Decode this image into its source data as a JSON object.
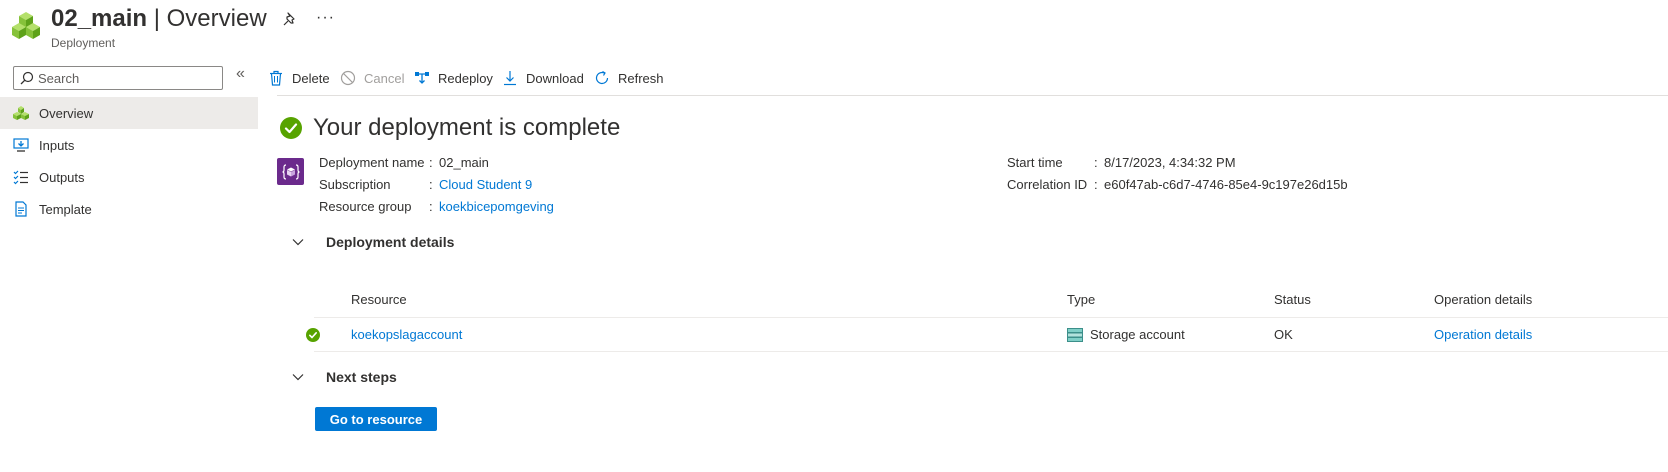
{
  "header": {
    "title_name": "02_main",
    "title_separator": " | ",
    "title_page": "Overview",
    "subtitle": "Deployment",
    "more_label": "···"
  },
  "sidebar": {
    "search_placeholder": "Search",
    "collapse_glyph": "«",
    "items": [
      {
        "label": "Overview",
        "icon": "deployment-cubes-icon",
        "active": true
      },
      {
        "label": "Inputs",
        "icon": "inputs-icon",
        "active": false
      },
      {
        "label": "Outputs",
        "icon": "outputs-icon",
        "active": false
      },
      {
        "label": "Template",
        "icon": "template-icon",
        "active": false
      }
    ]
  },
  "toolbar": {
    "delete": "Delete",
    "cancel": "Cancel",
    "redeploy": "Redeploy",
    "download": "Download",
    "refresh": "Refresh"
  },
  "main": {
    "status_title": "Your deployment is complete",
    "props_left": [
      {
        "label": "Deployment name",
        "value": "02_main",
        "link": false
      },
      {
        "label": "Subscription",
        "value": "Cloud Student 9",
        "link": true
      },
      {
        "label": "Resource group",
        "value": "koekbicepomgeving",
        "link": true
      }
    ],
    "props_right": [
      {
        "label": "Start time",
        "value": "8/17/2023, 4:34:32 PM"
      },
      {
        "label": "Correlation ID",
        "value": "e60f47ab-c6d7-4746-85e4-9c197e26d15b"
      }
    ],
    "prop_colon": ":",
    "deployment_details_title": "Deployment details",
    "table": {
      "headers": {
        "resource": "Resource",
        "type": "Type",
        "status": "Status",
        "operation": "Operation details"
      },
      "rows": [
        {
          "resource": "koekopslagaccount",
          "type": "Storage account",
          "status": "OK",
          "operation": "Operation details"
        }
      ]
    },
    "next_steps_title": "Next steps",
    "go_button": "Go to resource"
  },
  "colors": {
    "accent": "#0078d4",
    "success": "#57a300",
    "deployment_icon_bg": "#6b2a8c"
  }
}
